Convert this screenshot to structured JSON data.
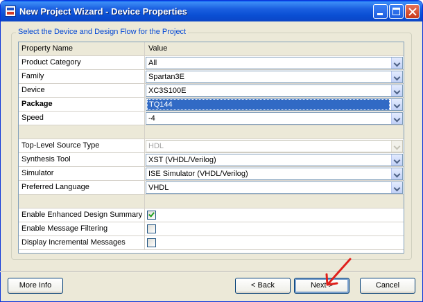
{
  "window": {
    "title": "New Project Wizard - Device Properties"
  },
  "group_label": "Select the Device and Design Flow for the Project",
  "grid": {
    "header": {
      "name": "Property Name",
      "value": "Value"
    },
    "rows": [
      {
        "name": "Product Category",
        "value": "All"
      },
      {
        "name": "Family",
        "value": "Spartan3E"
      },
      {
        "name": "Device",
        "value": "XC3S100E"
      },
      {
        "name": "Package",
        "value": "TQ144"
      },
      {
        "name": "Speed",
        "value": "-4"
      },
      {
        "name": "Top-Level Source Type",
        "value": "HDL"
      },
      {
        "name": "Synthesis Tool",
        "value": "XST (VHDL/Verilog)"
      },
      {
        "name": "Simulator",
        "value": "ISE Simulator (VHDL/Verilog)"
      },
      {
        "name": "Preferred Language",
        "value": "VHDL"
      },
      {
        "name": "Enable Enhanced Design Summary",
        "checked": true
      },
      {
        "name": "Enable Message Filtering",
        "checked": false
      },
      {
        "name": "Display Incremental Messages",
        "checked": false
      }
    ]
  },
  "buttons": {
    "more_info": "More Info",
    "back": "< Back",
    "next": "Next >",
    "cancel": "Cancel"
  },
  "annotation": {
    "color": "#e0201c"
  }
}
